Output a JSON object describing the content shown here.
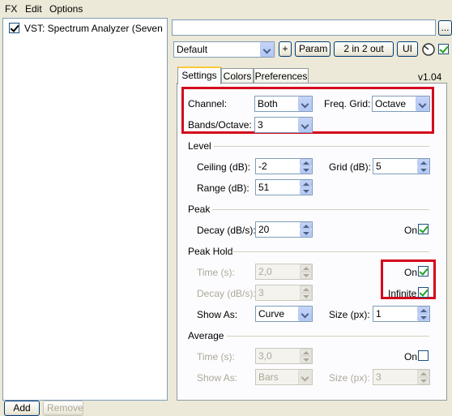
{
  "menu": {
    "items": [
      "FX",
      "Edit",
      "Options"
    ]
  },
  "fx_list": {
    "items": [
      {
        "label": "VST: Spectrum Analyzer (Seven",
        "checked": true
      }
    ]
  },
  "bottom_buttons": {
    "add": "Add",
    "remove": "Remove"
  },
  "header": {
    "search_value": "",
    "browse_label": "...",
    "preset": "Default",
    "plus_label": "+",
    "param_label": "Param",
    "io_label": "2 in 2 out",
    "ui_label": "UI",
    "enabled": true
  },
  "tabs": [
    {
      "label": "Settings",
      "active": true
    },
    {
      "label": "Colors",
      "active": false
    },
    {
      "label": "Preferences",
      "active": false
    }
  ],
  "version": "v1.04",
  "top_settings": {
    "channel_label": "Channel:",
    "channel_value": "Both",
    "freq_grid_label": "Freq. Grid:",
    "freq_grid_value": "Octave",
    "bands_label": "Bands/Octave:",
    "bands_value": "3"
  },
  "level": {
    "title": "Level",
    "ceiling_label": "Ceiling (dB):",
    "ceiling_value": "-2",
    "grid_label": "Grid (dB):",
    "grid_value": "5",
    "range_label": "Range (dB):",
    "range_value": "51"
  },
  "peak": {
    "title": "Peak",
    "decay_label": "Decay (dB/s):",
    "decay_value": "20",
    "on_label": "On",
    "on_checked": true
  },
  "peak_hold": {
    "title": "Peak Hold",
    "time_label": "Time (s):",
    "time_value": "2,0",
    "decay_label": "Decay (dB/s):",
    "decay_value": "3",
    "on_label": "On",
    "on_checked": true,
    "infinite_label": "Infinite",
    "infinite_checked": true,
    "show_as_label": "Show As:",
    "show_as_value": "Curve",
    "size_label": "Size (px):",
    "size_value": "1"
  },
  "average": {
    "title": "Average",
    "time_label": "Time (s):",
    "time_value": "3,0",
    "on_label": "On",
    "on_checked": false,
    "show_as_label": "Show As:",
    "show_as_value": "Bars",
    "size_label": "Size (px):",
    "size_value": "3"
  },
  "colors": {
    "highlight_box": "#d4071d",
    "check_green": "#21a121"
  }
}
